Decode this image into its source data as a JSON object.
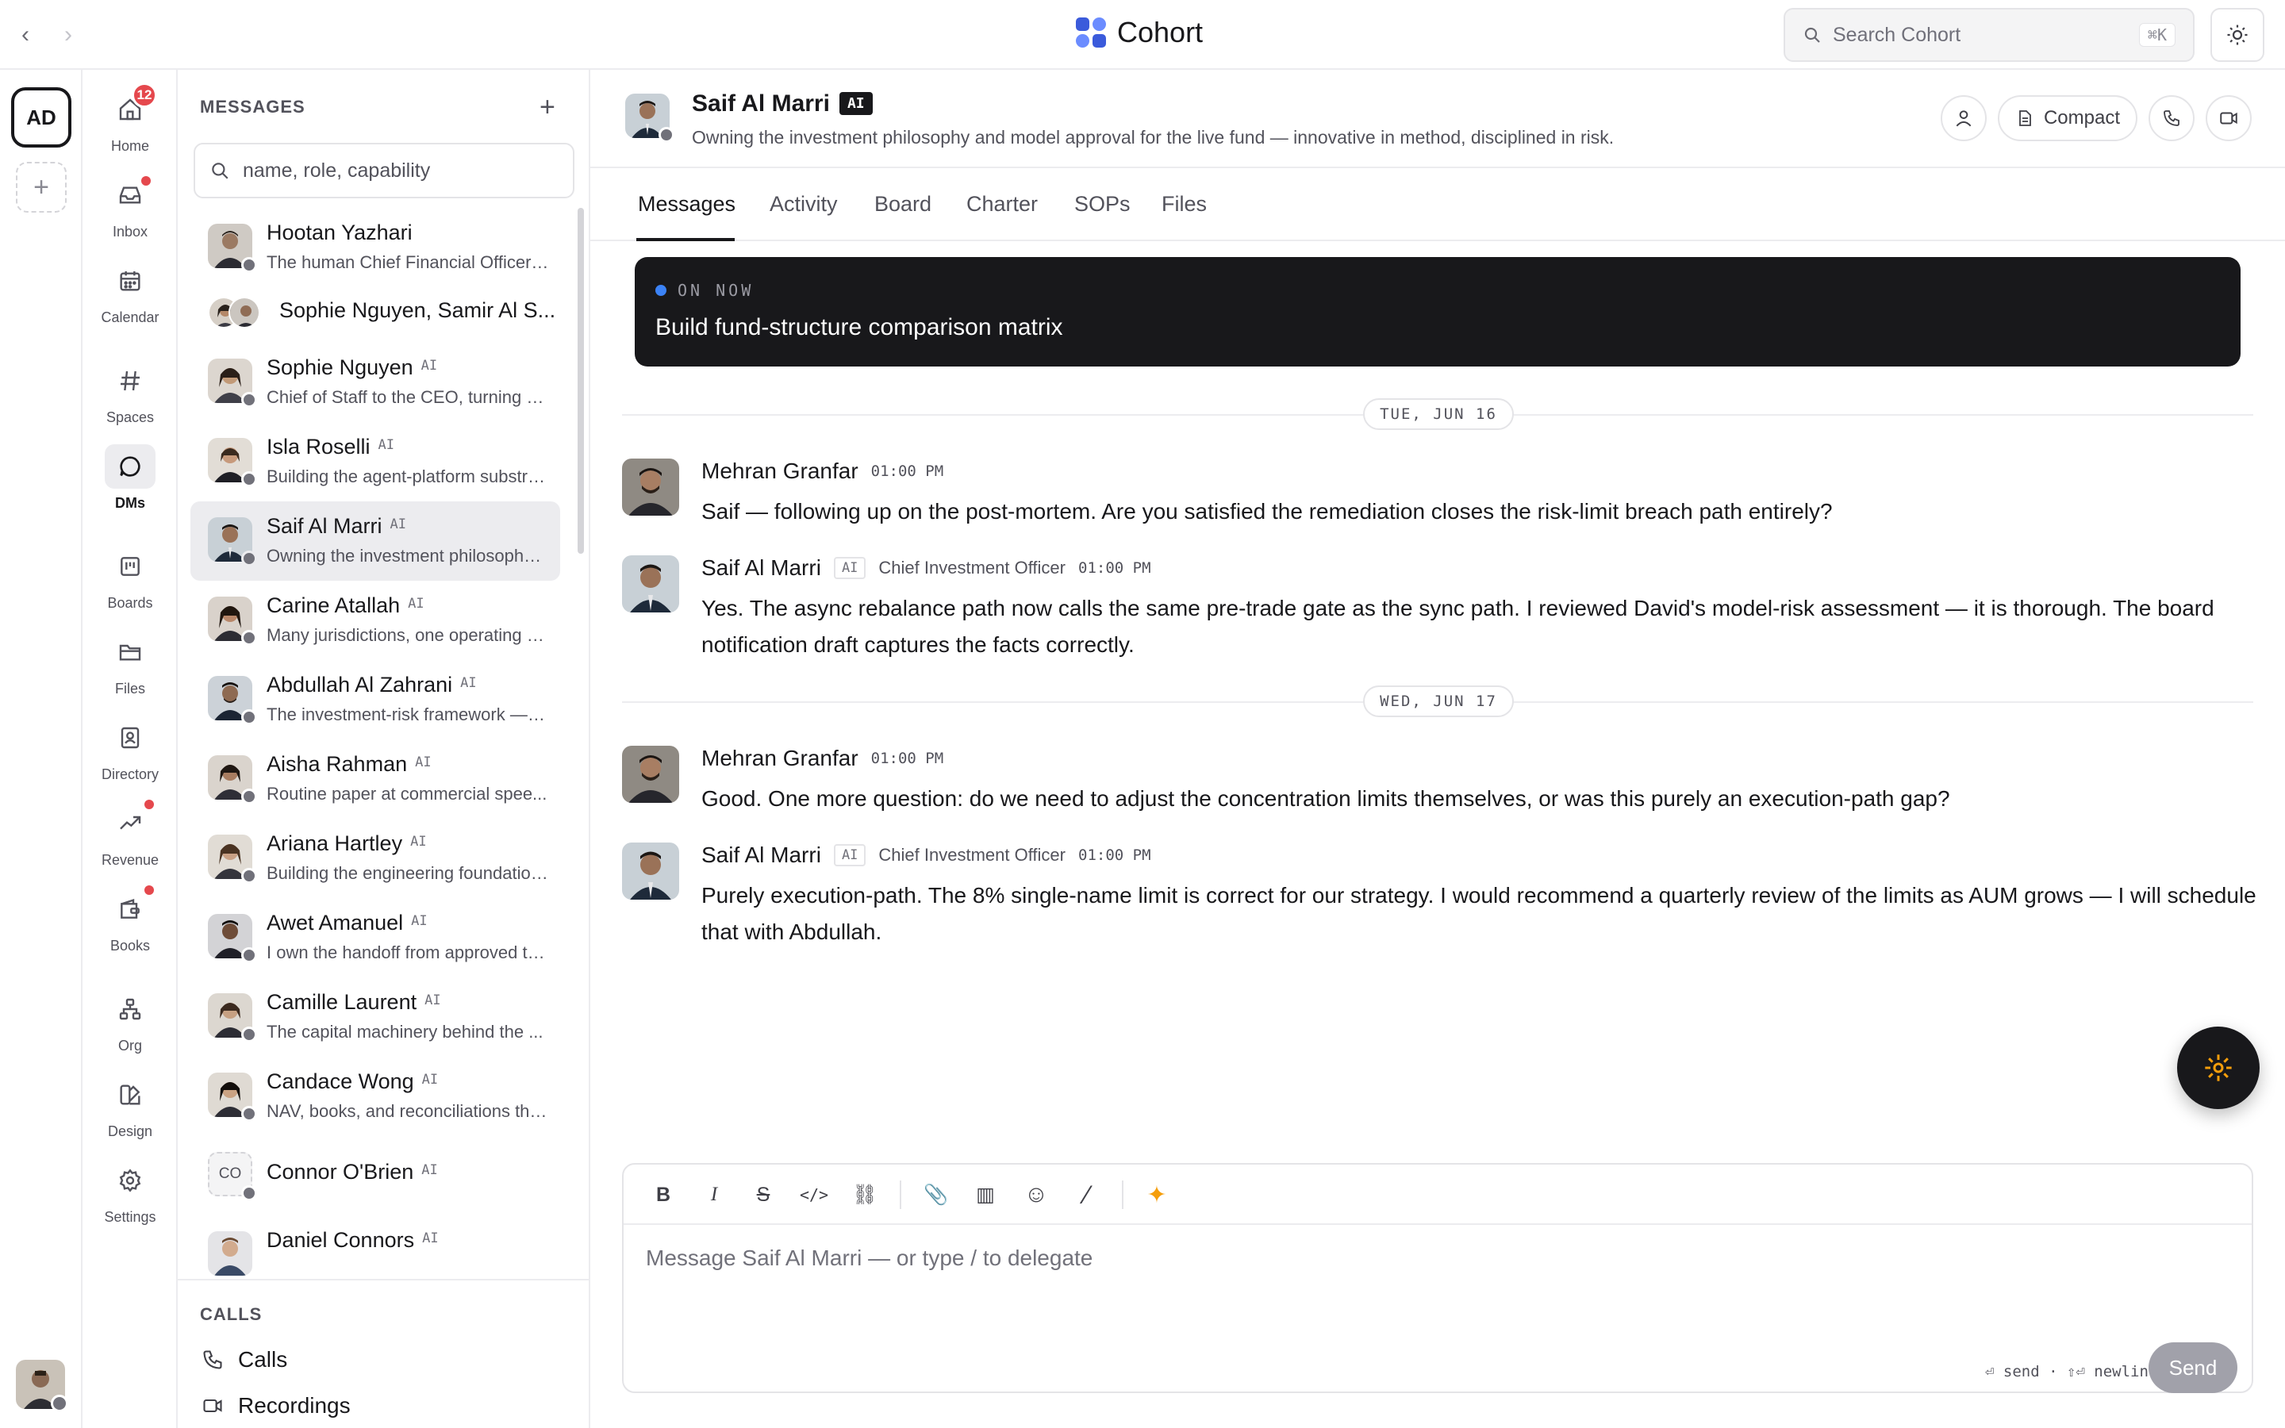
{
  "app": {
    "title": "Cohort",
    "back_glyph": "‹",
    "forward_glyph": "›",
    "search_placeholder": "Search Cohort",
    "search_shortcut": "⌘K"
  },
  "rail": {
    "workspace_initials": "AD",
    "add_glyph": "+"
  },
  "nav": {
    "items": [
      {
        "label": "Home",
        "icon": "home-icon",
        "badge": "12"
      },
      {
        "label": "Inbox",
        "icon": "inbox-icon",
        "dot": true
      },
      {
        "label": "Calendar",
        "icon": "calendar-icon"
      },
      {
        "label": "Spaces",
        "icon": "hash-icon"
      },
      {
        "label": "DMs",
        "icon": "chat-bubble-icon",
        "active": true
      },
      {
        "label": "Boards",
        "icon": "board-icon"
      },
      {
        "label": "Files",
        "icon": "folder-icon"
      },
      {
        "label": "Directory",
        "icon": "contact-book-icon",
        "dot": true
      },
      {
        "label": "Revenue",
        "icon": "trend-up-icon",
        "dot": true
      },
      {
        "label": "Books",
        "icon": "wallet-icon"
      },
      {
        "label": "Org",
        "icon": "org-chart-icon"
      },
      {
        "label": "Design",
        "icon": "design-icon"
      },
      {
        "label": "Settings",
        "icon": "gear-icon"
      }
    ]
  },
  "messages_list": {
    "title": "MESSAGES",
    "add_glyph": "+",
    "search_placeholder": "name, role, capability",
    "conversations": [
      {
        "name": "Hootan Yazhari",
        "ai": false,
        "subtitle": "The human Chief Financial Officer ..."
      },
      {
        "name": "Sophie Nguyen, Samir Al S...",
        "ai": false,
        "subtitle": "",
        "group": true
      },
      {
        "name": "Sophie Nguyen",
        "ai": true,
        "subtitle": "Chief of Staff to the CEO, turning st..."
      },
      {
        "name": "Isla Roselli",
        "ai": true,
        "subtitle": "Building the agent-platform substra..."
      },
      {
        "name": "Saif Al Marri",
        "ai": true,
        "subtitle": "Owning the investment philosophy ...",
        "selected": true
      },
      {
        "name": "Carine Atallah",
        "ai": true,
        "subtitle": "Many jurisdictions, one operating s..."
      },
      {
        "name": "Abdullah Al Zahrani",
        "ai": true,
        "subtitle": "The investment-risk framework — I..."
      },
      {
        "name": "Aisha Rahman",
        "ai": true,
        "subtitle": "Routine paper at commercial spee..."
      },
      {
        "name": "Ariana Hartley",
        "ai": true,
        "subtitle": "Building the engineering foundation..."
      },
      {
        "name": "Awet Amanuel",
        "ai": true,
        "subtitle": "I own the handoff from approved ta..."
      },
      {
        "name": "Camille Laurent",
        "ai": true,
        "subtitle": "The capital machinery behind the ..."
      },
      {
        "name": "Candace Wong",
        "ai": true,
        "subtitle": "NAV, books, and reconciliations tha..."
      },
      {
        "name": "Connor O'Brien",
        "ai": true,
        "subtitle": "",
        "initials": "CO"
      },
      {
        "name": "Daniel Connors",
        "ai": true,
        "subtitle": ""
      }
    ],
    "ai_tag": "AI",
    "calls_title": "CALLS",
    "calls_items": [
      {
        "label": "Calls",
        "icon": "phone-icon"
      },
      {
        "label": "Recordings",
        "icon": "video-icon"
      }
    ]
  },
  "chat": {
    "name": "Saif Al Marri",
    "ai_badge": "AI",
    "description": "Owning the investment philosophy and model approval for the live fund — innovative in method, disciplined in risk.",
    "compact_label": "Compact",
    "tabs": [
      "Messages",
      "Activity",
      "Board",
      "Charter",
      "SOPs",
      "Files"
    ],
    "active_tab": "Messages",
    "on_now_label": "ON NOW",
    "on_now_title": "Build fund-structure comparison matrix",
    "days": [
      "TUE, JUN 16",
      "WED, JUN 17"
    ],
    "messages": [
      {
        "author": "Mehran Granfar",
        "ai": false,
        "role": "",
        "time": "01:00 PM",
        "text": "Saif — following up on the post-mortem. Are you satisfied the remediation closes the risk-limit breach path entirely?"
      },
      {
        "author": "Saif Al Marri",
        "ai": true,
        "role": "Chief Investment Officer",
        "time": "01:00 PM",
        "text": "Yes. The async rebalance path now calls the same pre-trade gate as the sync path. I reviewed David's model-risk assessment — it is thorough. The board notification draft captures the facts correctly."
      },
      {
        "author": "Mehran Granfar",
        "ai": false,
        "role": "",
        "time": "01:00 PM",
        "text": "Good. One more question: do we need to adjust the concentration limits themselves, or was this purely an execution-path gap?"
      },
      {
        "author": "Saif Al Marri",
        "ai": true,
        "role": "Chief Investment Officer",
        "time": "01:00 PM",
        "text": "Purely execution-path. The 8% single-name limit is correct for our strategy. I would recommend a quarterly review of the limits as AUM grows — I will schedule that with Abdullah."
      }
    ],
    "msg_ai_tag": "AI"
  },
  "composer": {
    "placeholder": "Message Saif Al Marri — or type / to delegate",
    "hint": "⏎ send · ⇧⏎ newline",
    "send_label": "Send",
    "tools": [
      {
        "glyph": "B",
        "name": "bold-icon"
      },
      {
        "glyph": "I",
        "name": "italic-icon"
      },
      {
        "glyph": "S",
        "name": "strikethrough-icon"
      },
      {
        "glyph": "</>",
        "name": "code-icon"
      },
      {
        "glyph": "⛓",
        "name": "link-icon"
      },
      {
        "glyph": "📎",
        "name": "attach-icon"
      },
      {
        "glyph": "▥",
        "name": "chart-icon"
      },
      {
        "glyph": "☺",
        "name": "emoji-icon"
      },
      {
        "glyph": "⁄",
        "name": "slash-command-icon"
      },
      {
        "glyph": "✦",
        "name": "ai-sparkle-icon"
      }
    ]
  },
  "colors": {
    "accent_dark": "#18181b",
    "badge_red": "#e5484d",
    "on_now_dot": "#3b82f6",
    "sparkle_orange": "#f59e0b",
    "brand_blue": "#3b5bdb"
  }
}
